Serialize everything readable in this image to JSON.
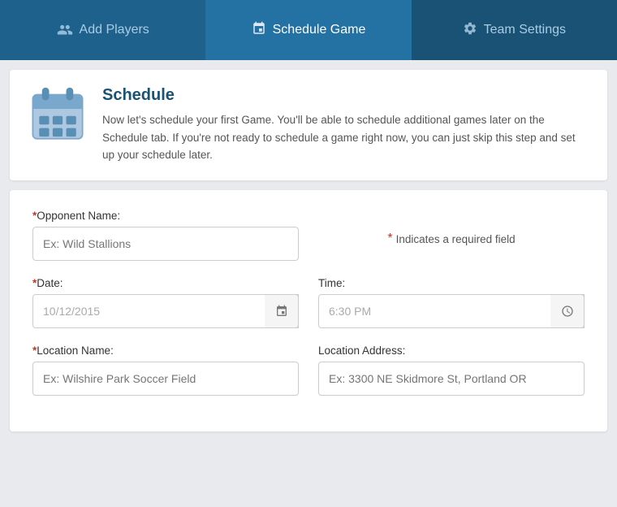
{
  "nav": {
    "tabs": [
      {
        "id": "add-players",
        "label": "Add Players",
        "icon": "👥",
        "active": false
      },
      {
        "id": "schedule-game",
        "label": "Schedule Game",
        "icon": "📅",
        "active": true
      },
      {
        "id": "team-settings",
        "label": "Team Settings",
        "icon": "⚙",
        "active": false
      }
    ]
  },
  "banner": {
    "title": "Schedule",
    "description": "Now let's schedule your first Game. You'll be able to schedule additional games later on the Schedule tab. If you're not ready to schedule a game right now, you can just skip this step and set up your schedule later."
  },
  "form": {
    "required_note": "Indicates a required field",
    "opponent_label": "Opponent Name:",
    "opponent_placeholder": "Ex: Wild Stallions",
    "date_label": "Date:",
    "date_value": "10/12/2015",
    "time_label": "Time:",
    "time_value": "6:30 PM",
    "location_name_label": "Location Name:",
    "location_name_placeholder": "Ex: Wilshire Park Soccer Field",
    "location_address_label": "Location Address:",
    "location_address_placeholder": "Ex: 3300 NE Skidmore St, Portland OR"
  }
}
